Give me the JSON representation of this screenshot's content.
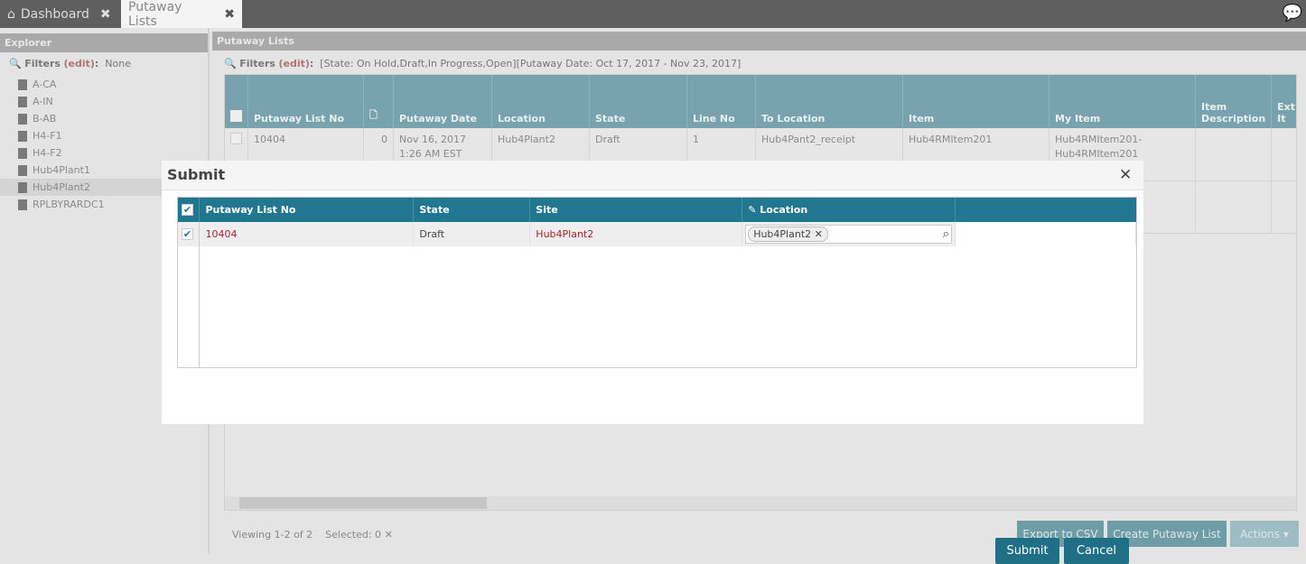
{
  "tabs": [
    {
      "label": "Dashboard"
    },
    {
      "label": "Putaway Lists"
    }
  ],
  "explorer": {
    "title": "Explorer",
    "filters_label": "Filters",
    "edit": "(edit)",
    "colon": ":",
    "filters_value": "None",
    "items": [
      "A-CA",
      "A-IN",
      "B-AB",
      "H4-F1",
      "H4-F2",
      "Hub4Plant1",
      "Hub4Plant2",
      "RPLBYRARDC1"
    ],
    "selected": "Hub4Plant2"
  },
  "main": {
    "title": "Putaway Lists",
    "filters_label": "Filters",
    "edit": "(edit)",
    "filters_value": "[State: On Hold,Draft,In Progress,Open][Putaway Date: Oct 17, 2017 - Nov 23, 2017]",
    "columns": [
      "Putaway List No",
      "",
      "Putaway Date",
      "Location",
      "State",
      "Line No",
      "To Location",
      "Item",
      "My Item",
      "Item Description",
      "Ext It"
    ],
    "rows": [
      {
        "no": "10404",
        "attach": "0",
        "date": "Nov 16, 2017 1:26 AM EST",
        "location": "Hub4Plant2",
        "state": "Draft",
        "line": "1",
        "to_location": "Hub4Pant2_receipt",
        "item": "Hub4RMItem201",
        "my_item": "Hub4RMItem201-Hub4RMItem201",
        "desc": "",
        "ext": ""
      }
    ],
    "footer": {
      "viewing": "Viewing 1-2 of 2",
      "selected": "Selected: 0"
    },
    "buttons": {
      "export": "Export to CSV",
      "create": "Create Putaway List",
      "actions": "Actions"
    }
  },
  "modal": {
    "title": "Submit",
    "columns": [
      "Putaway List No",
      "State",
      "Site",
      "Location"
    ],
    "rows": [
      {
        "no": "10404",
        "state": "Draft",
        "site": "Hub4Plant2",
        "location": "Hub4Plant2"
      }
    ],
    "submit": "Submit",
    "cancel": "Cancel"
  },
  "colors": {
    "header": "#21778f",
    "link": "#a4262c"
  }
}
